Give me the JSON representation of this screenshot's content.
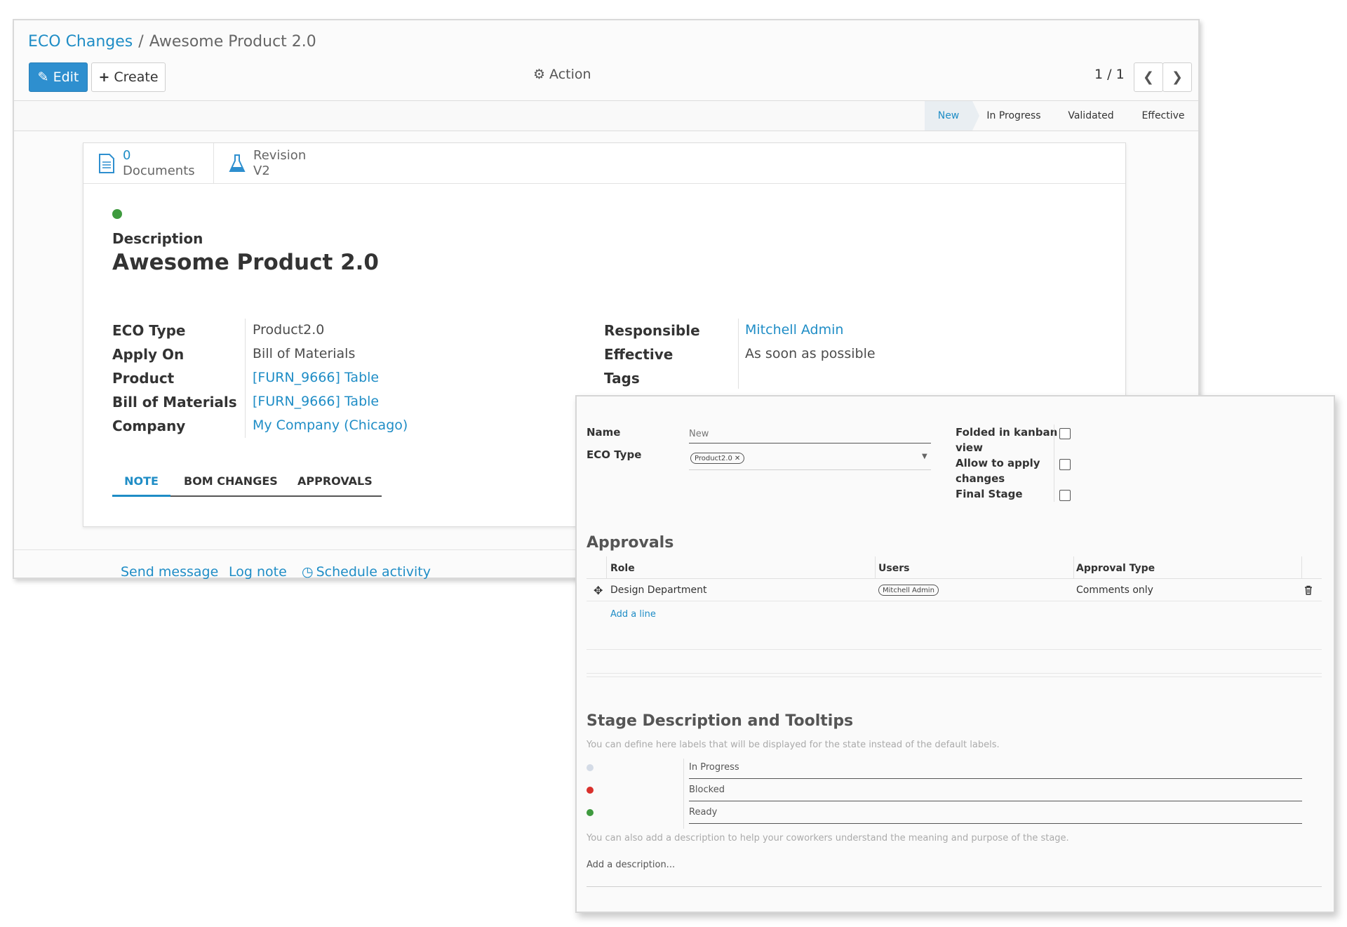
{
  "breadcrumb": {
    "parent": "ECO Changes",
    "separator": "/",
    "current": "Awesome Product 2.0"
  },
  "toolbar": {
    "edit_label": "Edit",
    "create_label": "Create",
    "action_label": "Action",
    "pager": "1 / 1"
  },
  "stages": [
    {
      "label": "New",
      "active": true
    },
    {
      "label": "In Progress",
      "active": false
    },
    {
      "label": "Validated",
      "active": false
    },
    {
      "label": "Effective",
      "active": false
    }
  ],
  "smart_buttons": {
    "documents": {
      "count": "0",
      "label": "Documents"
    },
    "revision": {
      "label": "Revision",
      "value": "V2"
    }
  },
  "form": {
    "description_label": "Description",
    "title": "Awesome Product 2.0",
    "left_fields": [
      {
        "label": "ECO Type",
        "value": "Product2.0",
        "link": false
      },
      {
        "label": "Apply On",
        "value": "Bill of Materials",
        "link": false
      },
      {
        "label": "Product",
        "value": "[FURN_9666] Table",
        "link": true
      },
      {
        "label": "Bill of Materials",
        "value": "[FURN_9666] Table",
        "link": true
      },
      {
        "label": "Company",
        "value": "My Company (Chicago)",
        "link": true
      }
    ],
    "right_fields": [
      {
        "label": "Responsible",
        "value": "Mitchell Admin",
        "link": true
      },
      {
        "label": "Effective",
        "value": "As soon as possible",
        "link": false
      },
      {
        "label": "Tags",
        "value": "",
        "link": false
      }
    ],
    "tabs": [
      {
        "label": "NOTE",
        "active": true
      },
      {
        "label": "BOM CHANGES",
        "active": false
      },
      {
        "label": "APPROVALS",
        "active": false
      }
    ]
  },
  "chatter": {
    "send_message": "Send message",
    "log_note": "Log note",
    "schedule_activity": "Schedule activity"
  },
  "stage_popup": {
    "name_label": "Name",
    "name_value": "New",
    "eco_type_label": "ECO Type",
    "eco_type_tag": "Product2.0",
    "folded_label_1": "Folded in kanban",
    "folded_label_2": "view",
    "allow_label_1": "Allow to apply",
    "allow_label_2": "changes",
    "final_label": "Final Stage",
    "approvals_title": "Approvals",
    "approvals_headers": {
      "role": "Role",
      "users": "Users",
      "type": "Approval Type"
    },
    "approval_row": {
      "role": "Design Department",
      "user": "Mitchell Admin",
      "type": "Comments only"
    },
    "add_line": "Add a line",
    "stage_desc_title": "Stage Description and Tooltips",
    "stage_desc_hint": "You can define here labels that will be displayed for the state instead of the default labels.",
    "states": [
      {
        "color": "#d4dbe6",
        "label": "In Progress"
      },
      {
        "color": "#d9302c",
        "label": "Blocked"
      },
      {
        "color": "#3e9a3e",
        "label": "Ready"
      }
    ],
    "desc_hint": "You can also add a description to help your coworkers understand the meaning and purpose of the stage.",
    "add_description": "Add a description..."
  },
  "colors": {
    "primary": "#2e8fcf",
    "link": "#1f8dc6",
    "status_dot": "#3e9a3e"
  }
}
